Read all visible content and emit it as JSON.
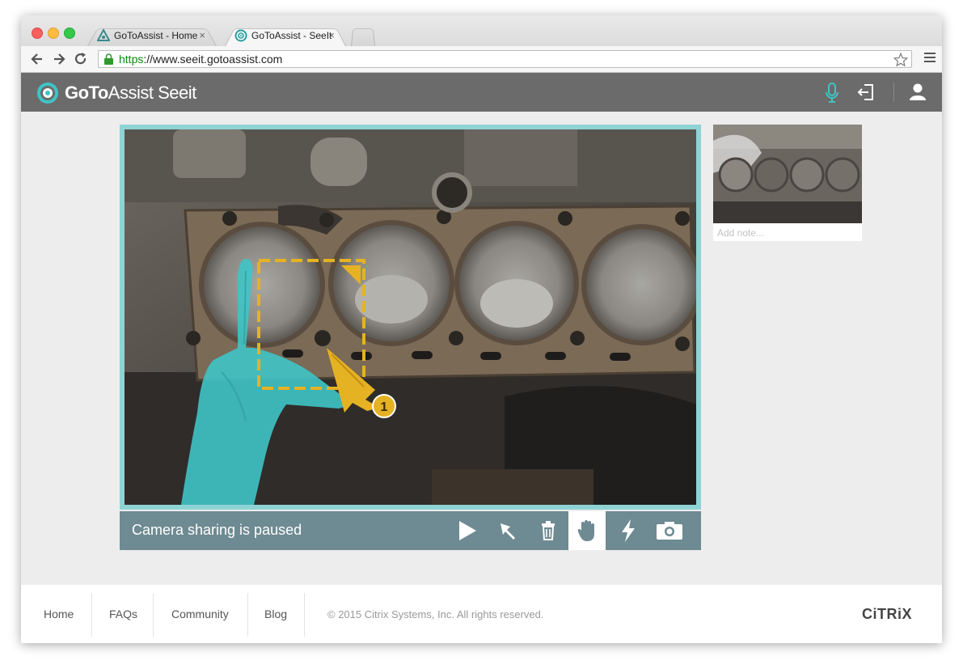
{
  "browser": {
    "tabs": [
      {
        "label": "GoToAssist - Home",
        "active": false
      },
      {
        "label": "GoToAssist - SeeIt",
        "active": true
      }
    ],
    "close_glyph": "×",
    "url_scheme": "https",
    "url_rest": "://www.seeit.gotoassist.com",
    "icons": [
      "back-icon",
      "forward-icon",
      "reload-icon",
      "lock-icon",
      "star-icon",
      "menu-icon"
    ]
  },
  "app": {
    "logo_bold": "GoTo",
    "logo_light": "Assist Seeit",
    "accent_color": "#3fc4c6",
    "header_icons": [
      "microphone-icon",
      "exit-icon",
      "user-icon"
    ]
  },
  "session": {
    "status_text": "Camera sharing is paused",
    "marker_number": "1",
    "tools": [
      {
        "name": "play-icon",
        "active": false
      },
      {
        "name": "pointer-icon",
        "active": false
      },
      {
        "name": "trash-icon",
        "active": false
      },
      {
        "name": "hand-icon",
        "active": true
      },
      {
        "name": "lightning-icon",
        "active": false
      },
      {
        "name": "camera-icon",
        "active": false
      }
    ]
  },
  "snapshot": {
    "note_placeholder": "Add note..."
  },
  "footer": {
    "links": [
      "Home",
      "FAQs",
      "Community",
      "Blog"
    ],
    "copyright": "© 2015 Citrix Systems, Inc. All rights reserved.",
    "brand": "CiTRiX"
  }
}
